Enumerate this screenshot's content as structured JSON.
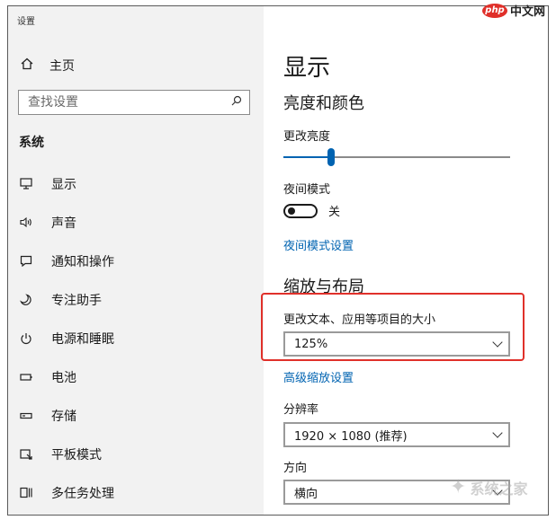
{
  "window": {
    "title": "设置"
  },
  "sidebar": {
    "home_label": "主页",
    "search_placeholder": "查找设置",
    "section_title": "系统",
    "items": [
      {
        "label": "显示",
        "icon": "monitor-icon"
      },
      {
        "label": "声音",
        "icon": "speaker-icon"
      },
      {
        "label": "通知和操作",
        "icon": "notification-icon"
      },
      {
        "label": "专注助手",
        "icon": "moon-icon"
      },
      {
        "label": "电源和睡眠",
        "icon": "power-icon"
      },
      {
        "label": "电池",
        "icon": "battery-icon"
      },
      {
        "label": "存储",
        "icon": "storage-icon"
      },
      {
        "label": "平板模式",
        "icon": "tablet-icon"
      },
      {
        "label": "多任务处理",
        "icon": "multitask-icon"
      }
    ]
  },
  "main": {
    "title": "显示",
    "brightness": {
      "heading": "亮度和颜色",
      "label": "更改亮度",
      "value_percent": 21
    },
    "night_light": {
      "label": "夜间模式",
      "state": "关",
      "settings_link": "夜间模式设置"
    },
    "scale": {
      "heading": "缩放与布局",
      "label": "更改文本、应用等项目的大小",
      "value": "125%",
      "advanced_link": "高级缩放设置"
    },
    "resolution": {
      "label": "分辨率",
      "value": "1920 × 1080 (推荐)"
    },
    "orientation": {
      "label": "方向",
      "value": "横向"
    }
  },
  "branding": {
    "logo_badge": "php",
    "logo_text": "中文网",
    "watermark": "系统之家"
  },
  "colors": {
    "accent": "#0063b1",
    "highlight": "#e0302a",
    "sidebar_bg": "#f2f2f2"
  }
}
